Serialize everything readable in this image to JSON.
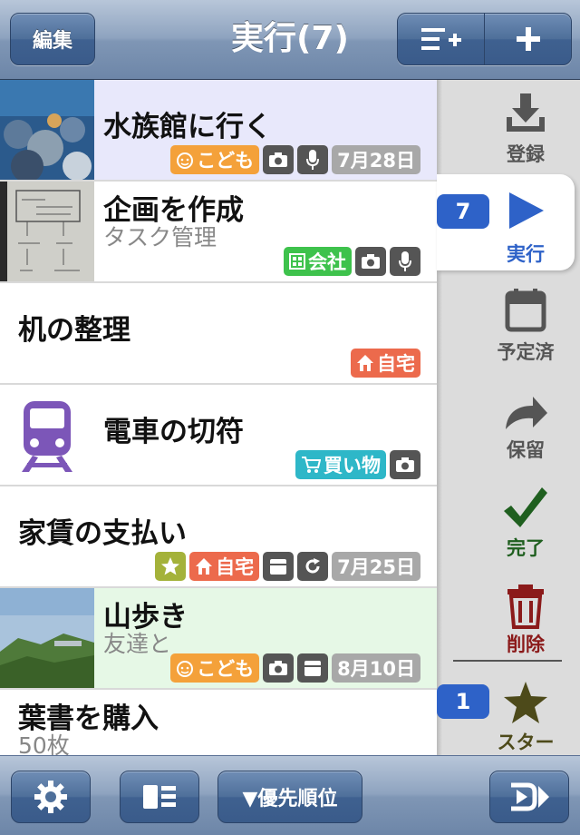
{
  "navbar": {
    "edit_label": "編集",
    "title": "実行(7)",
    "add_list_icon": "list-add-icon",
    "add_icon": "plus-icon"
  },
  "tasks": [
    {
      "title": "水族館に行く",
      "subtitle": "",
      "thumb": "aquarium-photo",
      "tags": [
        {
          "type": "kids",
          "label": "こども"
        },
        {
          "type": "camera"
        },
        {
          "type": "mic"
        },
        {
          "type": "date",
          "label": "7月28日"
        }
      ],
      "bg": "#e8e8fb"
    },
    {
      "title": "企画を作成",
      "subtitle": "タスク管理",
      "thumb": "sketch-photo",
      "tags": [
        {
          "type": "company",
          "label": "会社"
        },
        {
          "type": "camera"
        },
        {
          "type": "mic"
        }
      ],
      "bg": "#ffffff"
    },
    {
      "title": "机の整理",
      "subtitle": "",
      "thumb": "",
      "tags": [
        {
          "type": "home",
          "label": "自宅"
        }
      ],
      "bg": "#ffffff"
    },
    {
      "title": "電車の切符",
      "subtitle": "",
      "thumb": "train-icon",
      "tags": [
        {
          "type": "shop",
          "label": "買い物"
        },
        {
          "type": "camera"
        }
      ],
      "bg": "#ffffff"
    },
    {
      "title": "家賃の支払い",
      "subtitle": "",
      "thumb": "",
      "tags": [
        {
          "type": "star"
        },
        {
          "type": "home",
          "label": "自宅"
        },
        {
          "type": "calendar"
        },
        {
          "type": "repeat"
        },
        {
          "type": "date",
          "label": "7月25日"
        }
      ],
      "bg": "#ffffff"
    },
    {
      "title": "山歩き",
      "subtitle": "友達と",
      "thumb": "mountain-photo",
      "tags": [
        {
          "type": "kids",
          "label": "こども"
        },
        {
          "type": "camera"
        },
        {
          "type": "calendar"
        },
        {
          "type": "date",
          "label": "8月10日"
        }
      ],
      "bg": "#e6f8e6"
    },
    {
      "title": "葉書を購入",
      "subtitle": "50枚",
      "thumb": "",
      "tags": [],
      "bg": "#ffffff"
    }
  ],
  "sidebar": {
    "items": [
      {
        "label": "登録",
        "icon": "download-icon",
        "color": "#555555"
      },
      {
        "label": "実行",
        "icon": "play-icon",
        "color": "#2e62c8",
        "count": "7"
      },
      {
        "label": "予定済",
        "icon": "calendar-icon",
        "color": "#555555"
      },
      {
        "label": "保留",
        "icon": "redo-arrow-icon",
        "color": "#555555"
      },
      {
        "label": "完了",
        "icon": "checkmark-icon",
        "color": "#1f5f1f"
      },
      {
        "label": "削除",
        "icon": "trash-icon",
        "color": "#8b1a1a"
      },
      {
        "label": "スター",
        "icon": "star-icon",
        "color": "#4d4a1a",
        "count": "1"
      }
    ]
  },
  "toolbar": {
    "settings_icon": "gear-icon",
    "view_icon": "layout-icon",
    "sort_label": "▼優先順位",
    "export_icon": "export-arrow-icon"
  },
  "colors": {
    "accent": "#2e62c8",
    "kids": "#f4a13a",
    "company": "#3ec24c",
    "home": "#ec6a4c",
    "shop": "#2eb7c8",
    "star": "#a4b23a",
    "date": "#a8a8a8"
  }
}
